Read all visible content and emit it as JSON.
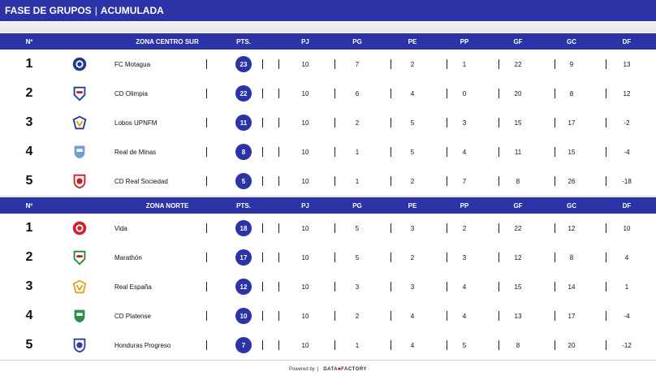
{
  "header": {
    "title_left": "FASE DE GRUPOS",
    "title_sep": "|",
    "title_right": "ACUMULADA"
  },
  "columns": {
    "pos": "Nº",
    "pts": "PTS.",
    "pj": "PJ",
    "pg": "PG",
    "pe": "PE",
    "pp": "PP",
    "gf": "GF",
    "gc": "GC",
    "df": "DF"
  },
  "groups": [
    {
      "zone": "ZONA CENTRO SUR",
      "rows": [
        {
          "pos": "1",
          "team": "FC Motagua",
          "pts": "23",
          "pj": "10",
          "pg": "7",
          "pe": "2",
          "pp": "1",
          "gf": "22",
          "gc": "9",
          "df": "13",
          "logo_color": "#1f3c8a"
        },
        {
          "pos": "2",
          "team": "CD Olimpia",
          "pts": "22",
          "pj": "10",
          "pg": "6",
          "pe": "4",
          "pp": "0",
          "gf": "20",
          "gc": "8",
          "df": "12",
          "logo_color": "#1b3fa8"
        },
        {
          "pos": "3",
          "team": "Lobos UPNFM",
          "pts": "11",
          "pj": "10",
          "pg": "2",
          "pe": "5",
          "pp": "3",
          "gf": "15",
          "gc": "17",
          "df": "-2",
          "logo_color": "#1d3d94"
        },
        {
          "pos": "4",
          "team": "Real de Minas",
          "pts": "8",
          "pj": "10",
          "pg": "1",
          "pe": "5",
          "pp": "4",
          "gf": "11",
          "gc": "15",
          "df": "-4",
          "logo_color": "#6f9fd4"
        },
        {
          "pos": "5",
          "team": "CD Real Sociedad",
          "pts": "5",
          "pj": "10",
          "pg": "1",
          "pe": "2",
          "pp": "7",
          "gf": "8",
          "gc": "26",
          "df": "-18",
          "logo_color": "#c7202a"
        }
      ]
    },
    {
      "zone": "ZONA NORTE",
      "rows": [
        {
          "pos": "1",
          "team": "Vida",
          "pts": "18",
          "pj": "10",
          "pg": "5",
          "pe": "3",
          "pp": "2",
          "gf": "22",
          "gc": "12",
          "df": "10",
          "logo_color": "#d0202c"
        },
        {
          "pos": "2",
          "team": "Marathón",
          "pts": "17",
          "pj": "10",
          "pg": "5",
          "pe": "2",
          "pp": "3",
          "gf": "12",
          "gc": "8",
          "df": "4",
          "logo_color": "#1f8a3a"
        },
        {
          "pos": "3",
          "team": "Real España",
          "pts": "12",
          "pj": "10",
          "pg": "3",
          "pe": "3",
          "pp": "4",
          "gf": "15",
          "gc": "14",
          "df": "1",
          "logo_color": "#e0a21a"
        },
        {
          "pos": "4",
          "team": "CD Platense",
          "pts": "10",
          "pj": "10",
          "pg": "2",
          "pe": "4",
          "pp": "4",
          "gf": "13",
          "gc": "17",
          "df": "-4",
          "logo_color": "#2f8f4a"
        },
        {
          "pos": "5",
          "team": "Honduras Progreso",
          "pts": "7",
          "pj": "10",
          "pg": "1",
          "pe": "4",
          "pp": "5",
          "gf": "8",
          "gc": "20",
          "df": "-12",
          "logo_color": "#2a3fa0"
        }
      ]
    }
  ],
  "footer": {
    "powered": "Powered by",
    "sep": "|",
    "brand_a": "DATA",
    "brand_b": "FACTORY"
  }
}
